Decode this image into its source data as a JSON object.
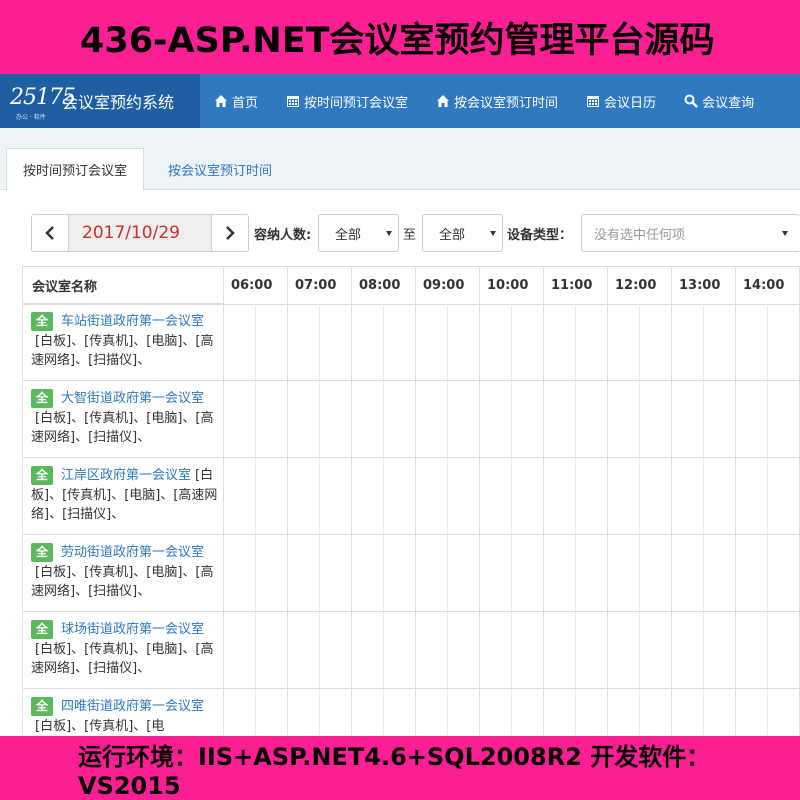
{
  "banner": {
    "top": "436-ASP.NET会议室预约管理平台源码",
    "bottom": "运行环境：IIS+ASP.NET4.6+SQL2008R2  开发软件：VS2015"
  },
  "navbar": {
    "logo_number": "25175",
    "logo_sub": "办公 · 软件",
    "brand": "会议室预约系统",
    "items": [
      {
        "label": "首页",
        "icon": "home-icon"
      },
      {
        "label": "按时间预订会议室",
        "icon": "calendar-icon"
      },
      {
        "label": "按会议室预订时间",
        "icon": "home-icon"
      },
      {
        "label": "会议日历",
        "icon": "calendar-icon"
      },
      {
        "label": "会议查询",
        "icon": "search-icon"
      }
    ]
  },
  "tabs": [
    {
      "label": "按时间预订会议室",
      "active": true
    },
    {
      "label": "按会议室预订时间",
      "active": false
    }
  ],
  "filter": {
    "date": "2017/10/29",
    "capacity_label": "容纳人数:",
    "capacity_from": "全部",
    "to_label": "至",
    "capacity_to": "全部",
    "equipment_label": "设备类型：",
    "equipment_placeholder": "没有选中任何项"
  },
  "table": {
    "room_header": "会议室名称",
    "hours": [
      "06:00",
      "07:00",
      "08:00",
      "09:00",
      "10:00",
      "11:00",
      "12:00",
      "13:00",
      "14:00"
    ],
    "rooms": [
      {
        "badge": "全",
        "name": "车站街道政府第一会议室",
        "equipment": "[白板]、[传真机]、[电脑]、[高速网络]、[扫描仪]、"
      },
      {
        "badge": "全",
        "name": "大智街道政府第一会议室",
        "equipment": "[白板]、[传真机]、[电脑]、[高速网络]、[扫描仪]、"
      },
      {
        "badge": "全",
        "name": "江岸区政府第一会议室",
        "equipment": "[白板]、[传真机]、[电脑]、[高速网络]、[扫描仪]、"
      },
      {
        "badge": "全",
        "name": "劳动街道政府第一会议室",
        "equipment": "[白板]、[传真机]、[电脑]、[高速网络]、[扫描仪]、"
      },
      {
        "badge": "全",
        "name": "球场街道政府第一会议室",
        "equipment": "[白板]、[传真机]、[电脑]、[高速网络]、[扫描仪]、"
      },
      {
        "badge": "全",
        "name": "四唯街道政府第一会议室",
        "equipment": "[白板]、[传真机]、[电"
      }
    ]
  },
  "colors": {
    "banner": "#ff1f95",
    "navbar": "#2f79c0",
    "brand_bg": "#1f5ea1",
    "link": "#2f79c0",
    "date_text": "#c9302c",
    "badge": "#5cb85c"
  }
}
